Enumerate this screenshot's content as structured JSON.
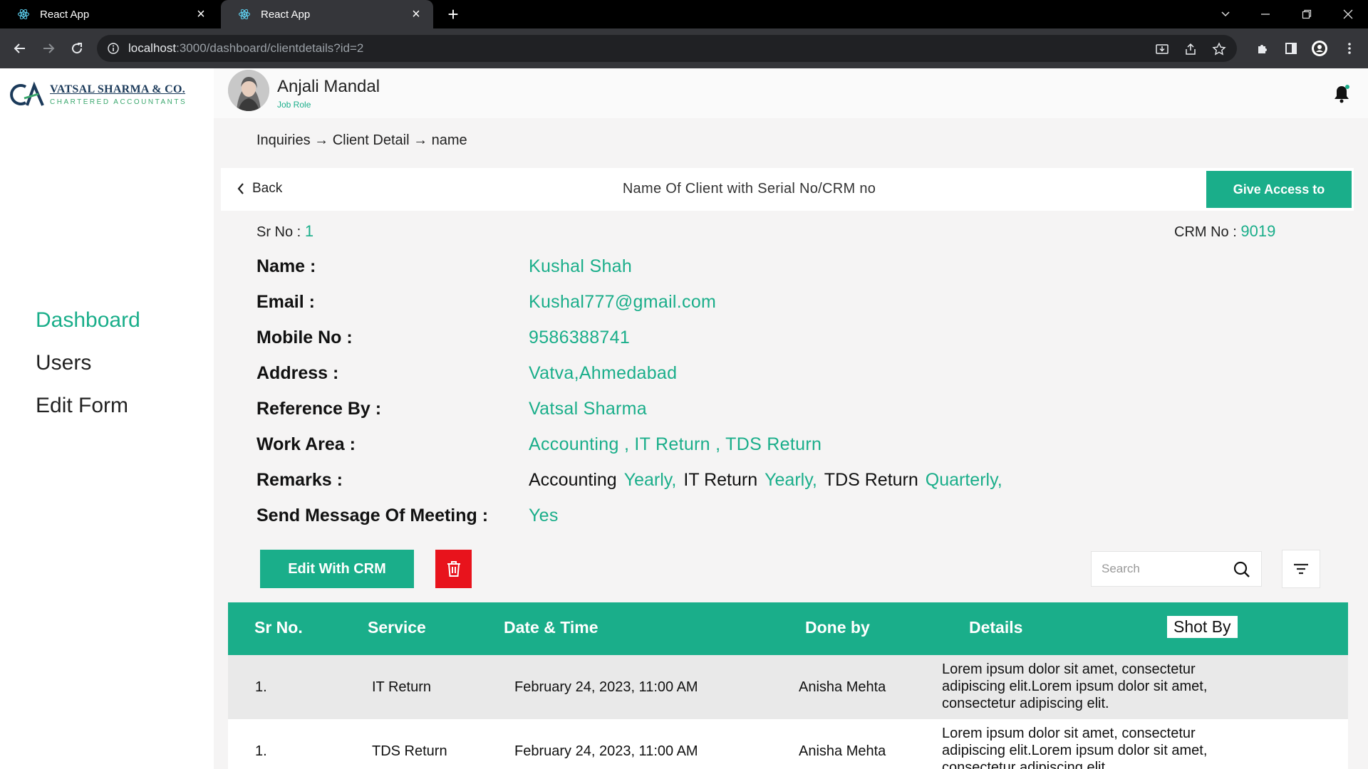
{
  "browser": {
    "tabs": [
      {
        "title": "React App",
        "active": false
      },
      {
        "title": "React App",
        "active": true
      }
    ],
    "url_host": "localhost",
    "url_path": ":3000/dashboard/clientdetails?id=2"
  },
  "sidebar": {
    "logo_name": "VATSAL SHARMA & CO.",
    "logo_sub": "CHARTERED ACCOUNTANTS",
    "items": [
      {
        "label": "Dashboard",
        "active": true
      },
      {
        "label": "Users",
        "active": false
      },
      {
        "label": "Edit Form",
        "active": false
      }
    ]
  },
  "user": {
    "name": "Anjali Mandal",
    "role": "Job Role"
  },
  "breadcrumb": "Inquiries → Client Detail → name",
  "header": {
    "back_label": "Back",
    "title": "Name Of Client with Serial No/CRM no",
    "give_access_label": "Give Access to"
  },
  "client": {
    "sr_label": "Sr No :",
    "sr_value": "1",
    "crm_label": "CRM No :",
    "crm_value": "9019",
    "fields": {
      "name": {
        "label": "Name :",
        "value": "Kushal Shah"
      },
      "email": {
        "label": "Email :",
        "value": "Kushal777@gmail.com"
      },
      "mobile": {
        "label": "Mobile No :",
        "value": "9586388741"
      },
      "address": {
        "label": "Address :",
        "value": "Vatva,Ahmedabad"
      },
      "reference": {
        "label": "Reference By :",
        "value": "Vatsal Sharma"
      },
      "work_area": {
        "label": "Work Area :",
        "value": "Accounting , IT Return , TDS Return"
      },
      "remarks": {
        "label": "Remarks :",
        "items": [
          {
            "service": "Accounting",
            "freq": "Yearly,"
          },
          {
            "service": "IT Return",
            "freq": "Yearly,"
          },
          {
            "service": "TDS Return",
            "freq": "Quarterly,"
          }
        ]
      },
      "meeting": {
        "label": "Send Message Of Meeting :",
        "value": "Yes"
      }
    }
  },
  "actions": {
    "edit_label": "Edit With CRM",
    "search_placeholder": "Search"
  },
  "table": {
    "headers": [
      "Sr No.",
      "Service",
      "Date & Time",
      "Done by",
      "Details",
      "Shot By"
    ],
    "rows": [
      {
        "sr": "1.",
        "service": "IT Return",
        "datetime": "February 24, 2023, 11:00 AM",
        "done_by": "Anisha Mehta",
        "details": "Lorem ipsum dolor sit amet, consectetur adipiscing elit.Lorem ipsum dolor sit amet, consectetur adipiscing elit."
      },
      {
        "sr": "1.",
        "service": "TDS Return",
        "datetime": "February 24, 2023, 11:00 AM",
        "done_by": "Anisha Mehta",
        "details": "Lorem ipsum dolor sit amet, consectetur adipiscing elit.Lorem ipsum dolor sit amet, consectetur adipiscing elit."
      }
    ]
  },
  "colors": {
    "accent": "#1aae8a",
    "danger": "#e8131c",
    "brand_navy": "#1b3a5a"
  }
}
